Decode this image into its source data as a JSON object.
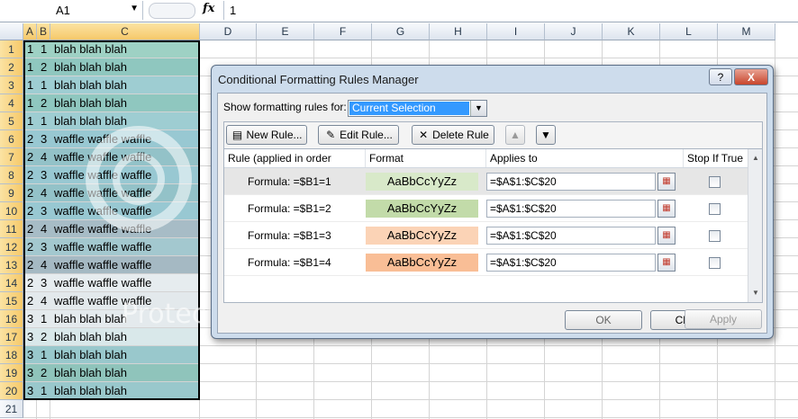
{
  "formula_bar": {
    "name_box": "A1",
    "fx": "fx",
    "value": "1"
  },
  "columns": [
    "A",
    "B",
    "C",
    "D",
    "E",
    "F",
    "G",
    "H",
    "I",
    "J",
    "K",
    "L",
    "M"
  ],
  "rows": [
    {
      "n": "1",
      "a": "1",
      "b": "1",
      "c": "blah blah blah",
      "fill": "#9ed1c4"
    },
    {
      "n": "2",
      "a": "1",
      "b": "2",
      "c": "blah blah blah",
      "fill": "#8fc7bf"
    },
    {
      "n": "3",
      "a": "1",
      "b": "1",
      "c": "blah blah blah",
      "fill": "#9ecdd2"
    },
    {
      "n": "4",
      "a": "1",
      "b": "2",
      "c": "blah blah blah",
      "fill": "#8fc7bf"
    },
    {
      "n": "5",
      "a": "1",
      "b": "1",
      "c": "blah blah blah",
      "fill": "#9ecdd2"
    },
    {
      "n": "6",
      "a": "2",
      "b": "3",
      "c": "waffle waffle waffle",
      "fill": "#98c8d2"
    },
    {
      "n": "7",
      "a": "2",
      "b": "4",
      "c": "waffle waffle waffle",
      "fill": "#93c2c8"
    },
    {
      "n": "8",
      "a": "2",
      "b": "3",
      "c": "waffle waffle waffle",
      "fill": "#98c8d2"
    },
    {
      "n": "9",
      "a": "2",
      "b": "4",
      "c": "waffle waffle waffle",
      "fill": "#93c2c8"
    },
    {
      "n": "10",
      "a": "2",
      "b": "3",
      "c": "waffle waffle waffle",
      "fill": "#98c8d2"
    },
    {
      "n": "11",
      "a": "2",
      "b": "4",
      "c": "waffle waffle waffle",
      "fill": "#a7bcc6"
    },
    {
      "n": "12",
      "a": "2",
      "b": "3",
      "c": "waffle waffle waffle",
      "fill": "#a3c8cf"
    },
    {
      "n": "13",
      "a": "2",
      "b": "4",
      "c": "waffle waffle waffle",
      "fill": "#a5b9c3"
    },
    {
      "n": "14",
      "a": "2",
      "b": "3",
      "c": "waffle waffle waffle",
      "fill": "#e6ecef"
    },
    {
      "n": "15",
      "a": "2",
      "b": "4",
      "c": "waffle waffle waffle",
      "fill": "#e3e9ec"
    },
    {
      "n": "16",
      "a": "3",
      "b": "1",
      "c": "blah blah blah",
      "fill": "#e4eaed"
    },
    {
      "n": "17",
      "a": "3",
      "b": "2",
      "c": "blah blah blah",
      "fill": "#d9e8ea"
    },
    {
      "n": "18",
      "a": "3",
      "b": "1",
      "c": "blah blah blah",
      "fill": "#99c8cc"
    },
    {
      "n": "19",
      "a": "3",
      "b": "2",
      "c": "blah blah blah",
      "fill": "#8fc4bb"
    },
    {
      "n": "20",
      "a": "3",
      "b": "1",
      "c": "blah blah blah",
      "fill": "#99c8cc"
    },
    {
      "n": "21",
      "a": "",
      "b": "",
      "c": "",
      "fill": "#ffffff"
    }
  ],
  "dialog": {
    "title": "Conditional Formatting Rules Manager",
    "help_label": "?",
    "close_label": "X",
    "show_label": "Show formatting rules for:",
    "selection": "Current Selection",
    "new_rule": "New Rule...",
    "edit_rule": "Edit Rule...",
    "delete_rule": "Delete Rule",
    "col_rule": "Rule (applied in order shown)",
    "col_format": "Format",
    "col_applies": "Applies to",
    "col_stop": "Stop If True",
    "rules": [
      {
        "formula": "Formula: =$B1=1",
        "preview": "AaBbCcYyZz",
        "color": "#d8e9c9",
        "applies": "=$A$1:$C$20"
      },
      {
        "formula": "Formula: =$B1=2",
        "preview": "AaBbCcYyZz",
        "color": "#c2dba9",
        "applies": "=$A$1:$C$20"
      },
      {
        "formula": "Formula: =$B1=3",
        "preview": "AaBbCcYyZz",
        "color": "#fbd3b6",
        "applies": "=$A$1:$C$20"
      },
      {
        "formula": "Formula: =$B1=4",
        "preview": "AaBbCcYyZz",
        "color": "#f9be96",
        "applies": "=$A$1:$C$20"
      }
    ],
    "ok": "OK",
    "close": "Close",
    "apply": "Apply"
  },
  "watermark": {
    "brand": "photobucket",
    "tagline": "Protect more of your memories for less!"
  }
}
